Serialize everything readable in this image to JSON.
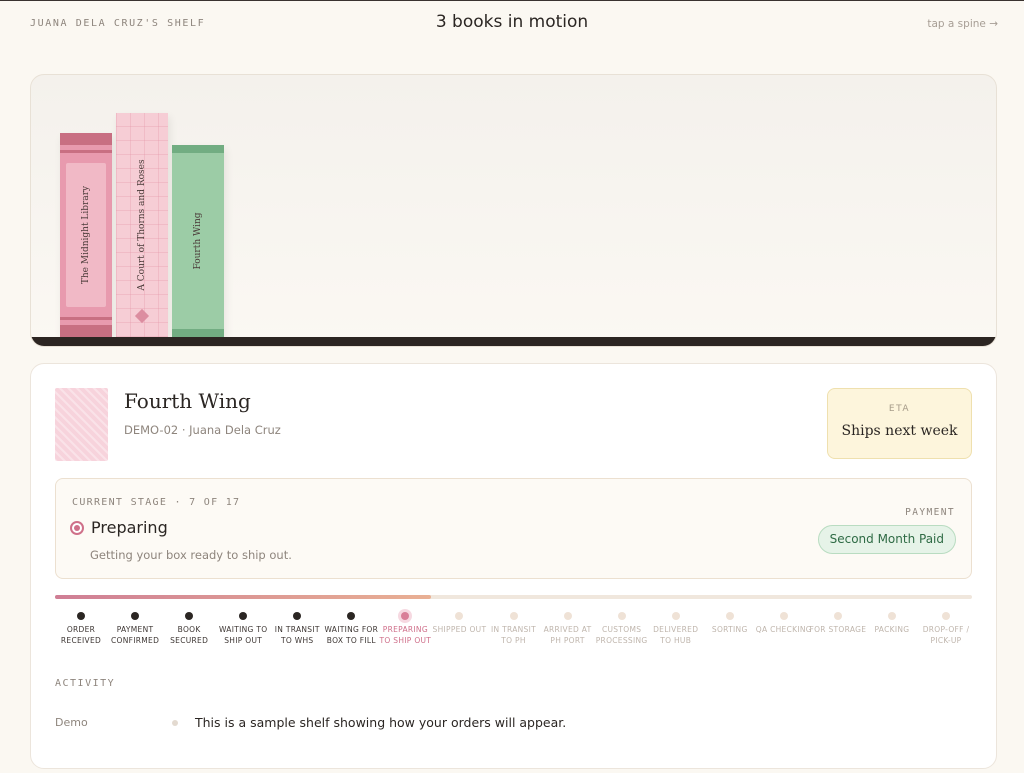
{
  "header": {
    "owner": "JUANA DELA CRUZ'S SHELF",
    "headline": "3 books in motion",
    "hint": "tap a spine →"
  },
  "shelf": {
    "books": [
      {
        "title": "The Midnight Library",
        "color": "#e89aae"
      },
      {
        "title": "A Court of Thorns and Roses",
        "color": "#f6cdd5"
      },
      {
        "title": "Fourth Wing",
        "color": "#9ccca6"
      }
    ]
  },
  "detail": {
    "title": "Fourth Wing",
    "meta": "DEMO-02 · Juana Dela Cruz",
    "eta_label": "ETA",
    "eta_value": "Ships next week"
  },
  "stage": {
    "counter": "CURRENT STAGE · 7 OF 17",
    "name": "Preparing",
    "description": "Getting your box ready to ship out.",
    "payment_label": "PAYMENT",
    "payment_status": "Second Month Paid",
    "progress_fraction": 0.41
  },
  "timeline": [
    {
      "label": "Order Received",
      "state": "done"
    },
    {
      "label": "Payment Confirmed",
      "state": "done"
    },
    {
      "label": "Book Secured",
      "state": "done"
    },
    {
      "label": "Waiting to Ship Out",
      "state": "done"
    },
    {
      "label": "In Transit to WHS",
      "state": "done"
    },
    {
      "label": "Waiting for Box to Fill",
      "state": "done"
    },
    {
      "label": "Preparing to Ship Out",
      "state": "current"
    },
    {
      "label": "Shipped Out",
      "state": "pending"
    },
    {
      "label": "In Transit to PH",
      "state": "pending"
    },
    {
      "label": "Arrived at PH Port",
      "state": "pending"
    },
    {
      "label": "Customs Processing",
      "state": "pending"
    },
    {
      "label": "Delivered to Hub",
      "state": "pending"
    },
    {
      "label": "Sorting",
      "state": "pending"
    },
    {
      "label": "QA Checking",
      "state": "pending"
    },
    {
      "label": "For Storage",
      "state": "pending"
    },
    {
      "label": "Packing",
      "state": "pending"
    },
    {
      "label": "Drop-off / Pick-up",
      "state": "pending"
    }
  ],
  "activity": {
    "title": "ACTIVITY",
    "entries": [
      {
        "who": "Demo",
        "text": "This is a sample shelf showing how your orders will appear."
      }
    ]
  },
  "colors": {
    "accent": "#cf7089",
    "payment_badge": "#e6f3e8",
    "eta_bg": "#fdf5dc"
  }
}
